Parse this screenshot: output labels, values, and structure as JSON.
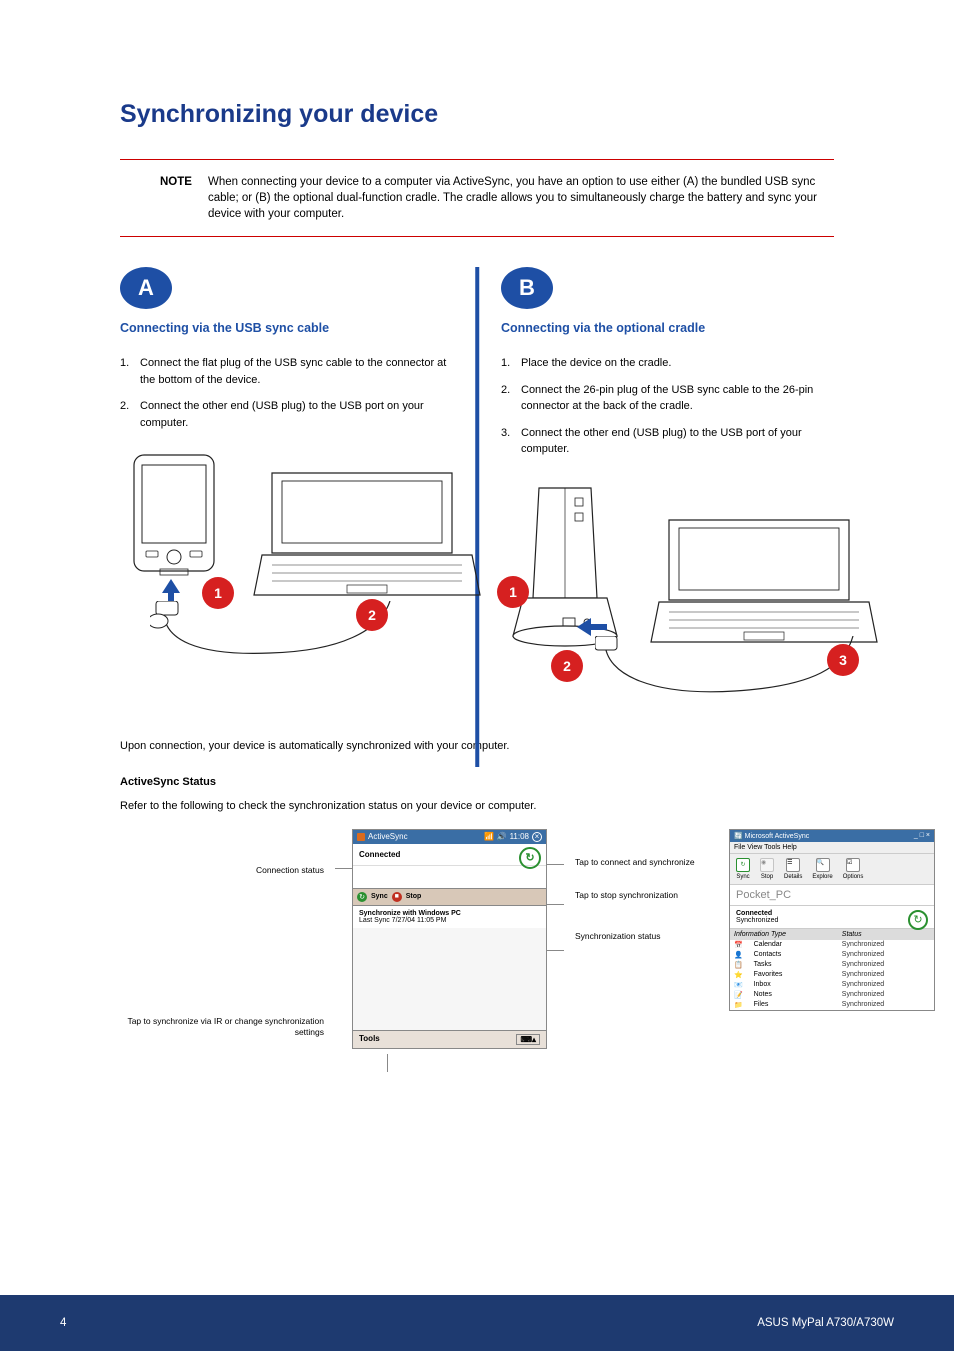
{
  "heading": "Synchronizing your device",
  "note": {
    "label": "NOTE",
    "text": "When connecting your device to a computer via ActiveSync, you have an option to use either (A) the bundled USB sync cable; or (B) the optional dual-function cradle. The cradle allows you to simultaneously charge the battery and sync your device with your computer."
  },
  "optionA": {
    "badge": "A",
    "title": "Connecting via the USB sync cable",
    "step1_num": "1.",
    "step1": "Connect the flat plug of the USB sync cable to the connector at the bottom of the device.",
    "step2_num": "2.",
    "step2": "Connect the other end (USB plug) to the USB port on your computer.",
    "dot1": "1",
    "dot2": "2"
  },
  "optionB": {
    "badge": "B",
    "title": "Connecting via the optional cradle",
    "step1_num": "1.",
    "step1": "Place the device on the cradle.",
    "step2_num": "2.",
    "step2": "Connect the 26-pin plug of the USB sync cable to the 26-pin connector at the back of the cradle.",
    "step3_num": "3.",
    "step3": "Connect the other end (USB plug) to the USB port of your computer.",
    "dot1": "1",
    "dot2": "2",
    "dot3": "3"
  },
  "body": {
    "p1": "Upon connection, your device is automatically synchronized with your computer.",
    "heading": "ActiveSync Status",
    "p2": "Refer to the following to check the synchronization status on your device or computer."
  },
  "callouts_left": {
    "c1": "Connection status",
    "c2": "Tap to synchronize via IR or change synchronization settings"
  },
  "callouts_right": {
    "c1": "Tap to connect and synchronize",
    "c2": "Tap to stop synchronization",
    "c3": "Synchronization status"
  },
  "pda_screen": {
    "titlebar": "ActiveSync",
    "time": "11:08",
    "connected": "Connected",
    "sync": "Sync",
    "stop": "Stop",
    "line1": "Synchronize with Windows PC",
    "line2": "Last Sync  7/27/04  11:05 PM",
    "tools": "Tools"
  },
  "win_screen": {
    "title": "Microsoft ActiveSync",
    "menu": "File   View   Tools   Help",
    "tb_sync": "Sync",
    "tb_stop": "Stop",
    "tb_details": "Details",
    "tb_explore": "Explore",
    "tb_options": "Options",
    "device": "Pocket_PC",
    "connected": "Connected",
    "synced": "Synchronized",
    "col1": "Information Type",
    "col2": "Status",
    "rows": [
      {
        "icon": "📅",
        "name": "Calendar",
        "status": "Synchronized"
      },
      {
        "icon": "👤",
        "name": "Contacts",
        "status": "Synchronized"
      },
      {
        "icon": "📋",
        "name": "Tasks",
        "status": "Synchronized"
      },
      {
        "icon": "⭐",
        "name": "Favorites",
        "status": "Synchronized"
      },
      {
        "icon": "📧",
        "name": "Inbox",
        "status": "Synchronized"
      },
      {
        "icon": "📝",
        "name": "Notes",
        "status": "Synchronized"
      },
      {
        "icon": "📁",
        "name": "Files",
        "status": "Synchronized"
      }
    ]
  },
  "footer": {
    "left": "4",
    "right": "ASUS MyPal A730/A730W"
  }
}
